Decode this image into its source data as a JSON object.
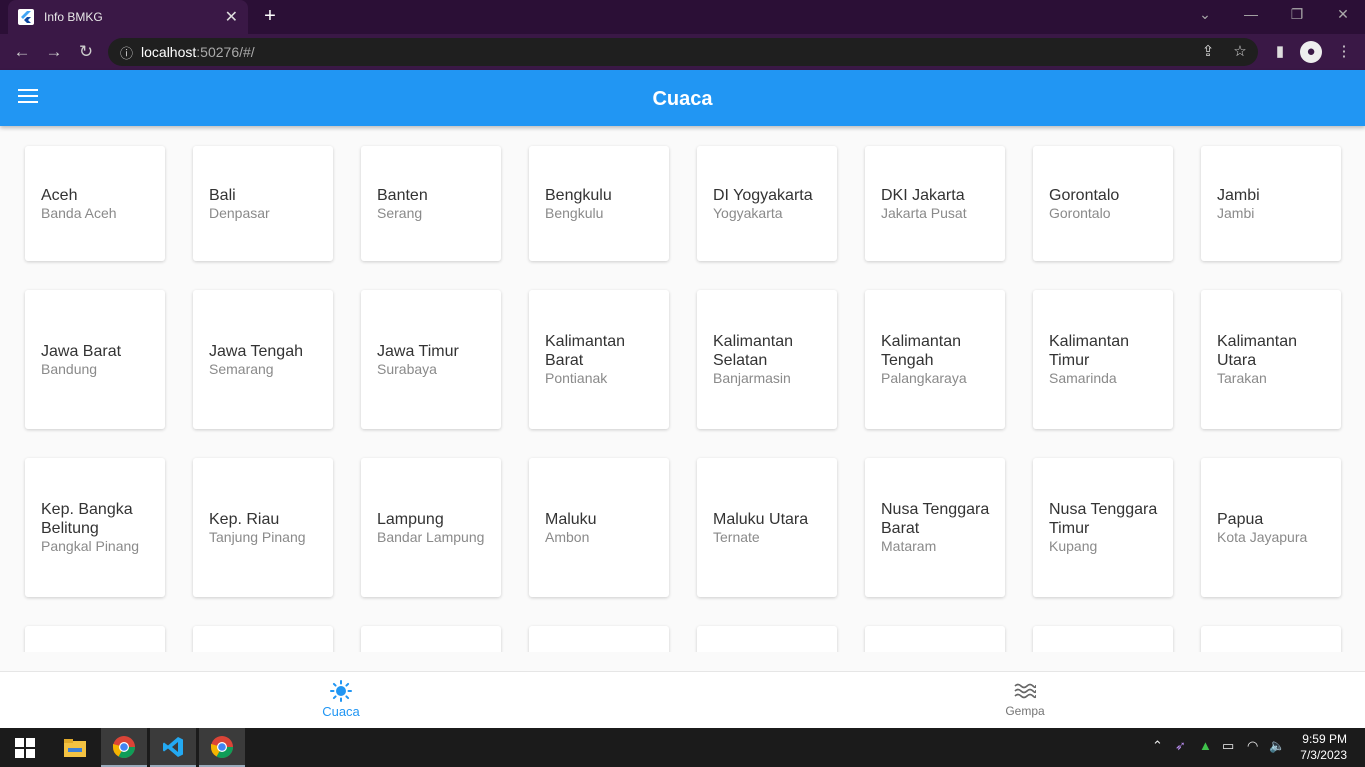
{
  "browser": {
    "tab_title": "Info BMKG",
    "url_host": "localhost",
    "url_rest": ":50276/#/"
  },
  "appbar": {
    "title": "Cuaca"
  },
  "cards": [
    {
      "province": "Aceh",
      "city": "Banda Aceh"
    },
    {
      "province": "Bali",
      "city": "Denpasar"
    },
    {
      "province": "Banten",
      "city": "Serang"
    },
    {
      "province": "Bengkulu",
      "city": "Bengkulu"
    },
    {
      "province": "DI Yogyakarta",
      "city": "Yogyakarta"
    },
    {
      "province": "DKI Jakarta",
      "city": "Jakarta Pusat"
    },
    {
      "province": "Gorontalo",
      "city": "Gorontalo"
    },
    {
      "province": "Jambi",
      "city": "Jambi"
    },
    {
      "province": "Jawa Barat",
      "city": "Bandung"
    },
    {
      "province": "Jawa Tengah",
      "city": "Semarang"
    },
    {
      "province": "Jawa Timur",
      "city": "Surabaya"
    },
    {
      "province": "Kalimantan Barat",
      "city": "Pontianak"
    },
    {
      "province": "Kalimantan Selatan",
      "city": "Banjarmasin"
    },
    {
      "province": "Kalimantan Tengah",
      "city": "Palangkaraya"
    },
    {
      "province": "Kalimantan Timur",
      "city": "Samarinda"
    },
    {
      "province": "Kalimantan Utara",
      "city": "Tarakan"
    },
    {
      "province": "Kep. Bangka Belitung",
      "city": "Pangkal Pinang"
    },
    {
      "province": "Kep. Riau",
      "city": "Tanjung Pinang"
    },
    {
      "province": "Lampung",
      "city": "Bandar Lampung"
    },
    {
      "province": "Maluku",
      "city": "Ambon"
    },
    {
      "province": "Maluku Utara",
      "city": "Ternate"
    },
    {
      "province": "Nusa Tenggara Barat",
      "city": "Mataram"
    },
    {
      "province": "Nusa Tenggara Timur",
      "city": "Kupang"
    },
    {
      "province": "Papua",
      "city": "Kota Jayapura"
    }
  ],
  "bottom_nav": {
    "weather_label": "Cuaca",
    "quake_label": "Gempa",
    "active_color": "#2196f3",
    "inactive_color": "#757575"
  },
  "taskbar": {
    "time": "9:59 PM",
    "date": "7/3/2023"
  }
}
